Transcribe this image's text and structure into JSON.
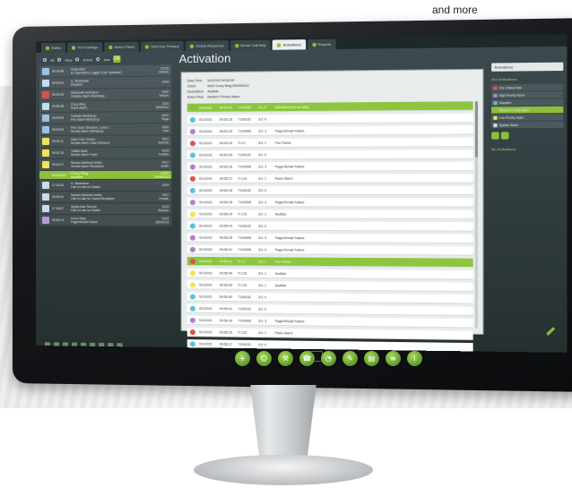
{
  "caption": "and more",
  "tabs": [
    {
      "label": "Status"
    },
    {
      "label": "Test Settings"
    },
    {
      "label": "Action Plans"
    },
    {
      "label": "Mod Key Primary"
    },
    {
      "label": "Global Response"
    },
    {
      "label": "Nurse Call Map"
    },
    {
      "label": "Activations"
    },
    {
      "label": "Reports"
    }
  ],
  "filters": {
    "all": "All",
    "new": "New",
    "active": "Active",
    "ack": "Ack",
    "ok": "OK"
  },
  "incidents": [
    {
      "time": "09:49:38",
      "desc": "Voice Alert\nEr Operations Logger (Cal. Operator)",
      "code": "12116\nRobots",
      "color": "#9bc4e2"
    },
    {
      "time": "09:50:02",
      "desc": "Lt. Buchanan\nDispatch",
      "code": "2003",
      "color": "#c7ddeb"
    },
    {
      "time": "09:50:29",
      "desc": "Ultrasonic Activation\nOutside Alarm Workshop",
      "code": "0002\nTonium",
      "color": "#d9534f"
    },
    {
      "time": "09:50:48",
      "desc": "Curry Ring\nPanic Alarm",
      "code": "2101\n15000112",
      "color": "#c7ddeb"
    },
    {
      "time": "09:50:53",
      "desc": "Outside Workshop\nFire Alarm Workshop",
      "code": "0001\nTinge",
      "color": "#9bc4e2"
    },
    {
      "time": "09:50:54",
      "desc": "Fire Outer Structure, Level 1\nSmoke Alarm Workshop",
      "code": "0002\nFlan",
      "color": "#9bc4e2"
    },
    {
      "time": "09:51:11",
      "desc": "Gate Door Sensor\nSmoke Alarm Gate Entrance",
      "code": "9011\nBuchan",
      "color": "#f0e35a"
    },
    {
      "time": "09:51:15",
      "desc": "Tuttles Main\nSmoke Alarm Foyer",
      "code": "0016\nTurbine",
      "color": "#f0e35a"
    },
    {
      "time": "09:51:27",
      "desc": "Nurses Medical Centre\nSmoke Alarm Reception",
      "code": "0017\nSmith",
      "color": "#f0e35a"
    },
    {
      "time": "09:53:00",
      "desc": "Curry Ring\nAudible",
      "code": "2101\n15000112",
      "color": "#8cbf3a",
      "selected": true
    },
    {
      "time": "17:01:02",
      "desc": "Lt. Buchanan\nCall In Late for Duties",
      "code": "2003",
      "color": "#c7ddeb"
    },
    {
      "time": "09:55:42",
      "desc": "Nurses Medical Centre\nCall In Late for Guest Reception",
      "code": "2007\nFeeder",
      "color": "#c7ddeb"
    },
    {
      "time": "17:05:07",
      "desc": "Spiderman Service\nCall In Late for Duties",
      "code": "2019\nBuchan",
      "color": "#c7ddeb"
    },
    {
      "time": "09:59:14",
      "desc": "Curry Ring\nPager/Email Failure",
      "code": "2101\n15000112",
      "color": "#b89ad6"
    }
  ],
  "main": {
    "title": "Activation",
    "meta": [
      {
        "k": "Date Time",
        "v": "5/1/2015 09:53:00"
      },
      {
        "k": "Client",
        "v": "9002   Curry Ring   900206110"
      },
      {
        "k": "Description",
        "v": "Audible"
      },
      {
        "k": "Action Plan",
        "v": "Medium Priority Alarm"
      }
    ]
  },
  "events": [
    {
      "d": "5/1/2015",
      "t": "09:53:01",
      "a": "T100095",
      "z": "ZU: 0",
      "note": "Activated (not on data)",
      "color": "#8cbf3a",
      "hl": true
    },
    {
      "d": "5/1/2015",
      "t": "09:53:16",
      "a": "T100102",
      "z": "ZU: 0",
      "note": "",
      "color": "#5bc0de"
    },
    {
      "d": "5/1/2015",
      "t": "09:53:24",
      "a": "T100095",
      "z": "ZU: 3",
      "note": "Pager/Email Failure",
      "color": "#b07fd1"
    },
    {
      "d": "5/1/2015",
      "t": "09:53:24",
      "a": "T:1:0",
      "z": "ZU: 1",
      "note": "Fire Flame",
      "color": "#d9534f"
    },
    {
      "d": "5/1/2015",
      "t": "09:53:30",
      "a": "T100102",
      "z": "ZU: 0",
      "note": "",
      "color": "#5bc0de"
    },
    {
      "d": "5/1/2015",
      "t": "09:55:16",
      "a": "T100095",
      "z": "ZU: 3",
      "note": "Pager/Email Failure",
      "color": "#b07fd1"
    },
    {
      "d": "5/1/2015",
      "t": "09:55:17",
      "a": "T:1:20",
      "z": "ZU: 1",
      "note": "Panic Alarm",
      "color": "#d9534f"
    },
    {
      "d": "5/1/2015",
      "t": "09:55:18",
      "a": "T100102",
      "z": "ZU: 0",
      "note": "",
      "color": "#5bc0de"
    },
    {
      "d": "5/1/2015",
      "t": "09:55:18",
      "a": "T100095",
      "z": "ZU: 3",
      "note": "Pager/Email Failure",
      "color": "#b07fd1"
    },
    {
      "d": "5/1/2015",
      "t": "09:55:24",
      "a": "T:1:20",
      "z": "ZU: 1",
      "note": "Audible",
      "color": "#f0e35a"
    },
    {
      "d": "5/1/2015",
      "t": "09:55:24",
      "a": "T100102",
      "z": "ZU: 0",
      "note": "",
      "color": "#5bc0de"
    },
    {
      "d": "5/1/2015",
      "t": "09:55:25",
      "a": "T100095",
      "z": "ZU: 3",
      "note": "Pager/Email Failure",
      "color": "#b07fd1"
    },
    {
      "d": "5/1/2015",
      "t": "09:55:31",
      "a": "T100095",
      "z": "ZU: 0",
      "note": "Pager/Email Failure",
      "color": "#b07fd1"
    },
    {
      "d": "5/1/2015",
      "t": "09:55:11",
      "a": "T:1:1",
      "z": "ZU: 1",
      "note": "Fire Flame",
      "color": "#d9534f",
      "hl": true
    },
    {
      "d": "5/1/2015",
      "t": "09:55:40",
      "a": "T:1:20",
      "z": "ZU: 1",
      "note": "Audible",
      "color": "#f0e35a"
    },
    {
      "d": "5/1/2015",
      "t": "09:55:40",
      "a": "T:1:20",
      "z": "ZU: 1",
      "note": "Audible",
      "color": "#f0e35a"
    },
    {
      "d": "5/1/2015",
      "t": "09:55:40",
      "a": "T100102",
      "z": "ZU: 0",
      "note": "",
      "color": "#5bc0de"
    },
    {
      "d": "5/1/2015",
      "t": "09:55:41",
      "a": "T100102",
      "z": "ZU: 0",
      "note": "",
      "color": "#5bc0de"
    },
    {
      "d": "5/1/2015",
      "t": "09:56:16",
      "a": "T100095",
      "z": "ZU: 3",
      "note": "Pager/Email Failure",
      "color": "#b07fd1"
    },
    {
      "d": "5/1/2015",
      "t": "09:56:16",
      "a": "T:1:20",
      "z": "ZU: 1",
      "note": "Panic Alarm",
      "color": "#d9534f"
    },
    {
      "d": "5/1/2015",
      "t": "09:56:17",
      "a": "T100102",
      "z": "ZU: 0",
      "note": "",
      "color": "#5bc0de"
    },
    {
      "d": "5/1/2015",
      "t": "09:56:45",
      "a": "T:1:1",
      "z": "ZU: 1",
      "note": "Fire Flame",
      "color": "#d9534f"
    }
  ],
  "right": {
    "select": "Activations",
    "section": "Ref Activations",
    "codes": [
      {
        "label": "Fire Critical Risk",
        "color": "#d9534f"
      },
      {
        "label": "High Priority Alarm",
        "color": "#b07fd1"
      },
      {
        "label": "Dispatch",
        "color": "#5bc0de"
      },
      {
        "label": "Medium Priority Alarm",
        "color": "#8cbf3a",
        "hl": true
      },
      {
        "label": "Low Priority Alarm",
        "color": "#f0e35a"
      },
      {
        "label": "System Alarm",
        "color": "#c7ddeb"
      }
    ],
    "section2": "No Activations"
  },
  "bottom_icons": [
    "plus",
    "user",
    "wrench",
    "phone",
    "gauge",
    "pencil",
    "chart",
    "list",
    "info"
  ]
}
